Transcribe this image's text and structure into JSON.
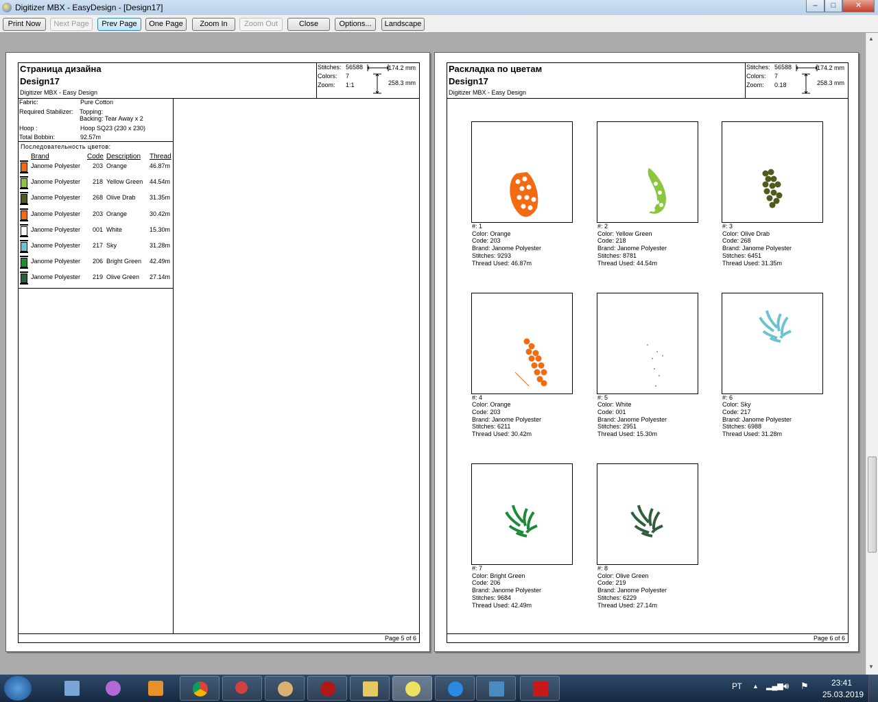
{
  "window": {
    "title": "Digitizer MBX - EasyDesign - [Design17]",
    "min": "–",
    "max": "□",
    "close": "✕"
  },
  "toolbar": {
    "print_now": "Print Now",
    "next_page": "Next Page",
    "prev_page": "Prev Page",
    "one_page": "One Page",
    "zoom_in": "Zoom In",
    "zoom_out": "Zoom Out",
    "close": "Close",
    "options": "Options...",
    "landscape": "Landscape"
  },
  "page5": {
    "title": "Страница дизайна",
    "design": "Design17",
    "subtitle": "Digitizer MBX -  Easy Design",
    "stats": {
      "stitches_label": "Stitches:",
      "stitches": "56588",
      "colors_label": "Colors:",
      "colors": "7",
      "zoom_label": "Zoom:",
      "zoom": "1:1",
      "width": "174.2 mm",
      "height": "258.3 mm"
    },
    "fabric_label": "Fabric:",
    "fabric": "Pure Cotton",
    "stabilizer_label": "Required Stabilizer:",
    "topping": "Topping:",
    "backing": "Backing: Tear Away x 2",
    "hoop_label": "Hoop :",
    "hoop": "Hoop SQ23 (230 x 230)",
    "bobbin_label": "Total Bobbin:",
    "bobbin": "92.57m",
    "sequence_label": "Последовательность цветов:",
    "col_brand": "Brand",
    "col_code": "Code",
    "col_desc": "Description",
    "col_thread": "Thread",
    "colors": [
      {
        "brand": "Janome Polyester",
        "code": "203",
        "desc": "Orange",
        "thread": "46.87m",
        "hex": "#f26b12"
      },
      {
        "brand": "Janome Polyester",
        "code": "218",
        "desc": "Yellow Green",
        "thread": "44.54m",
        "hex": "#8cc63f"
      },
      {
        "brand": "Janome Polyester",
        "code": "268",
        "desc": "Olive Drab",
        "thread": "31.35m",
        "hex": "#4f5a1f"
      },
      {
        "brand": "Janome Polyester",
        "code": "203",
        "desc": "Orange",
        "thread": "30.42m",
        "hex": "#f26b12"
      },
      {
        "brand": "Janome Polyester",
        "code": "001",
        "desc": "White",
        "thread": "15.30m",
        "hex": "#ffffff"
      },
      {
        "brand": "Janome Polyester",
        "code": "217",
        "desc": "Sky",
        "thread": "31.28m",
        "hex": "#6cc3cf"
      },
      {
        "brand": "Janome Polyester",
        "code": "206",
        "desc": "Bright Green",
        "thread": "42.49m",
        "hex": "#1e8a35"
      },
      {
        "brand": "Janome Polyester",
        "code": "219",
        "desc": "Olive Green",
        "thread": "27.14m",
        "hex": "#2f5e3a"
      }
    ],
    "footer": "Page 5 of 6"
  },
  "page6": {
    "title": "Раскладка по цветам",
    "design": "Design17",
    "subtitle": "Digitizer MBX -  Easy Design",
    "stats": {
      "stitches_label": "Stitches:",
      "stitches": "56588",
      "colors_label": "Colors:",
      "colors": "7",
      "zoom_label": "Zoom:",
      "zoom": "0.18",
      "width": "174.2 mm",
      "height": "258.3 mm"
    },
    "cells": [
      {
        "num": "#: 1",
        "color": "Color: Orange",
        "code": "Code: 203",
        "brand": "Brand: Janome Polyester",
        "stitches": "Stitches: 9293",
        "thread": "Thread Used: 46.87m",
        "hex": "#f26b12",
        "shape": "dots"
      },
      {
        "num": "#: 2",
        "color": "Color: Yellow Green",
        "code": "Code: 218",
        "brand": "Brand: Janome Polyester",
        "stitches": "Stitches: 8781",
        "thread": "Thread Used: 44.54m",
        "hex": "#8cc63f",
        "shape": "crescent"
      },
      {
        "num": "#: 3",
        "color": "Color: Olive Drab",
        "code": "Code: 268",
        "brand": "Brand: Janome Polyester",
        "stitches": "Stitches: 6451",
        "thread": "Thread Used: 31.35m",
        "hex": "#4f5a1f",
        "shape": "cluster"
      },
      {
        "num": "#: 4",
        "color": "Color: Orange",
        "code": "Code: 203",
        "brand": "Brand: Janome Polyester",
        "stitches": "Stitches: 6211",
        "thread": "Thread Used: 30.42m",
        "hex": "#f26b12",
        "shape": "cluster2"
      },
      {
        "num": "#: 5",
        "color": "Color: White",
        "code": "Code: 001",
        "brand": "Brand: Janome Polyester",
        "stitches": "Stitches: 2951",
        "thread": "Thread Used: 15.30m",
        "hex": "#dddddd",
        "shape": "specks"
      },
      {
        "num": "#: 6",
        "color": "Color: Sky",
        "code": "Code: 217",
        "brand": "Brand: Janome Polyester",
        "stitches": "Stitches: 6988",
        "thread": "Thread Used: 31.28m",
        "hex": "#6cc3cf",
        "shape": "leaves"
      },
      {
        "num": "#: 7",
        "color": "Color: Bright Green",
        "code": "Code: 206",
        "brand": "Brand: Janome Polyester",
        "stitches": "Stitches: 9684",
        "thread": "Thread Used: 42.49m",
        "hex": "#1e8a35",
        "shape": "leaves"
      },
      {
        "num": "#: 8",
        "color": "Color: Olive Green",
        "code": "Code: 219",
        "brand": "Brand: Janome Polyester",
        "stitches": "Stitches: 6229",
        "thread": "Thread Used: 27.14m",
        "hex": "#2f5e3a",
        "shape": "leaves"
      }
    ],
    "footer": "Page 6 of 6"
  },
  "taskbar": {
    "lang": "РТ",
    "time": "23:41",
    "date": "25.03.2019"
  }
}
